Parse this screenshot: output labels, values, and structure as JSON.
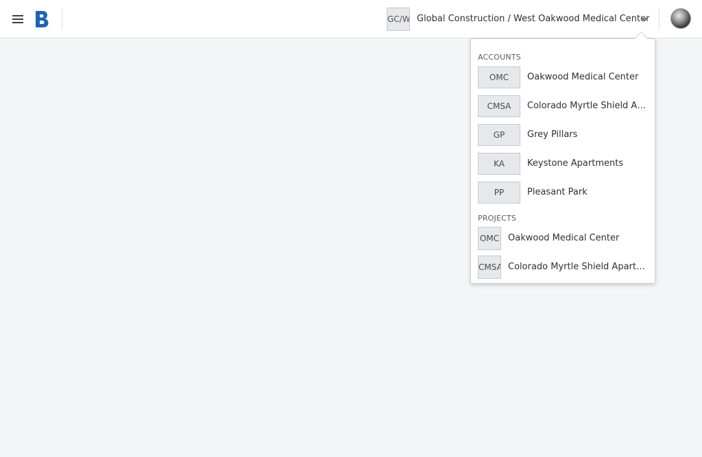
{
  "header": {
    "menu_icon": "hamburger-menu-icon",
    "logo_icon": "b-logo-icon",
    "brand_color": "#1f63b1",
    "context": {
      "badge": "GC/W",
      "label": "Global Construction / West Oakwood Medical Center",
      "chevron_icon": "chevron-down-icon"
    },
    "avatar_icon": "user-avatar-icon"
  },
  "dropdown": {
    "accounts_heading": "ACCOUNTS",
    "accounts": [
      {
        "badge": "OMC",
        "name": "Oakwood Medical Center"
      },
      {
        "badge": "CMSA",
        "name": "Colorado Myrtle Shield Apartments"
      },
      {
        "badge": "GP",
        "name": "Grey Pillars"
      },
      {
        "badge": "KA",
        "name": "Keystone Apartments"
      },
      {
        "badge": "PP",
        "name": "Pleasant Park"
      }
    ],
    "projects_heading": "PROJECTS",
    "projects": [
      {
        "badge": "OMC",
        "name": "Oakwood Medical Center"
      },
      {
        "badge": "CMSA",
        "name": "Colorado Myrtle Shield Apartments"
      }
    ]
  }
}
